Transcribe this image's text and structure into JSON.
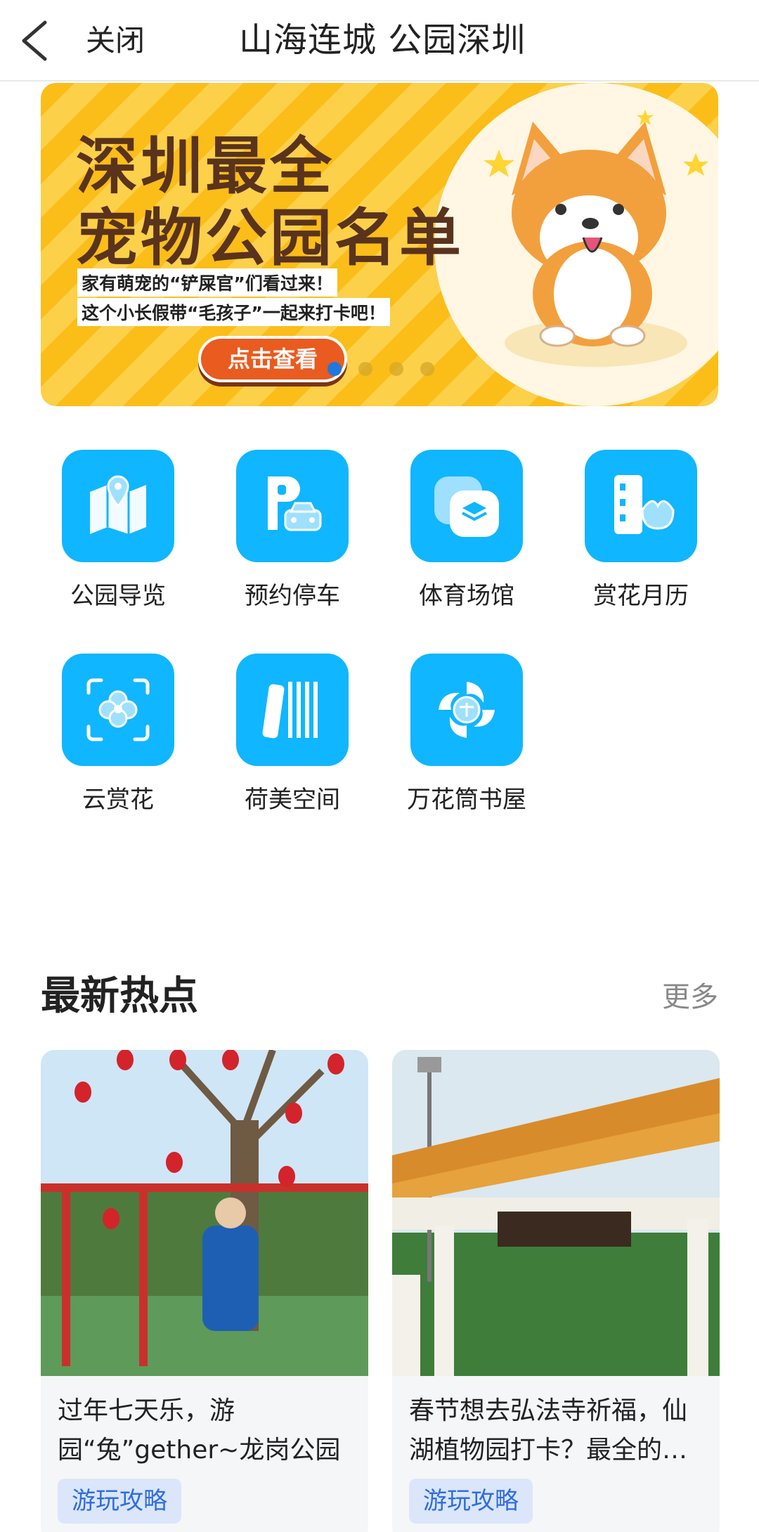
{
  "header": {
    "back_icon": "chevron-left-icon",
    "close_label": "关闭",
    "title": "山海连城 公园深圳"
  },
  "banner": {
    "line1": "深圳最全",
    "line2": "宠物公园名单",
    "sub1": "家有萌宠的“铲屎官”们看过来！",
    "sub2": "这个小长假带“毛孩子”一起来打卡吧！",
    "button": "点击查看",
    "active_dot": 0
  },
  "grid": [
    {
      "label": "公园导览",
      "icon": "map-pin-icon"
    },
    {
      "label": "预约停车",
      "icon": "parking-car-icon"
    },
    {
      "label": "体育场馆",
      "icon": "layers-icon"
    },
    {
      "label": "赏花月历",
      "icon": "building-flower-icon"
    },
    {
      "label": "云赏花",
      "icon": "flower-scan-icon"
    },
    {
      "label": "荷美空间",
      "icon": "books-icon"
    },
    {
      "label": "万花筒书屋",
      "icon": "kaleidoscope-book-icon"
    }
  ],
  "section": {
    "title": "最新热点",
    "more": "更多"
  },
  "cards": [
    {
      "title": "过年七天乐，游园“兔”gether~龙岗公园新春活…",
      "tag": "游玩攻略"
    },
    {
      "title": "春节想去弘法寺祈福，仙湖植物园打卡？最全的…",
      "tag": "游玩攻略"
    }
  ],
  "colors": {
    "accent": "#10b6ff",
    "banner_yellow": "#fbbd18",
    "tag_text": "#2f6ddf",
    "tag_bg": "#dbe6fb"
  }
}
